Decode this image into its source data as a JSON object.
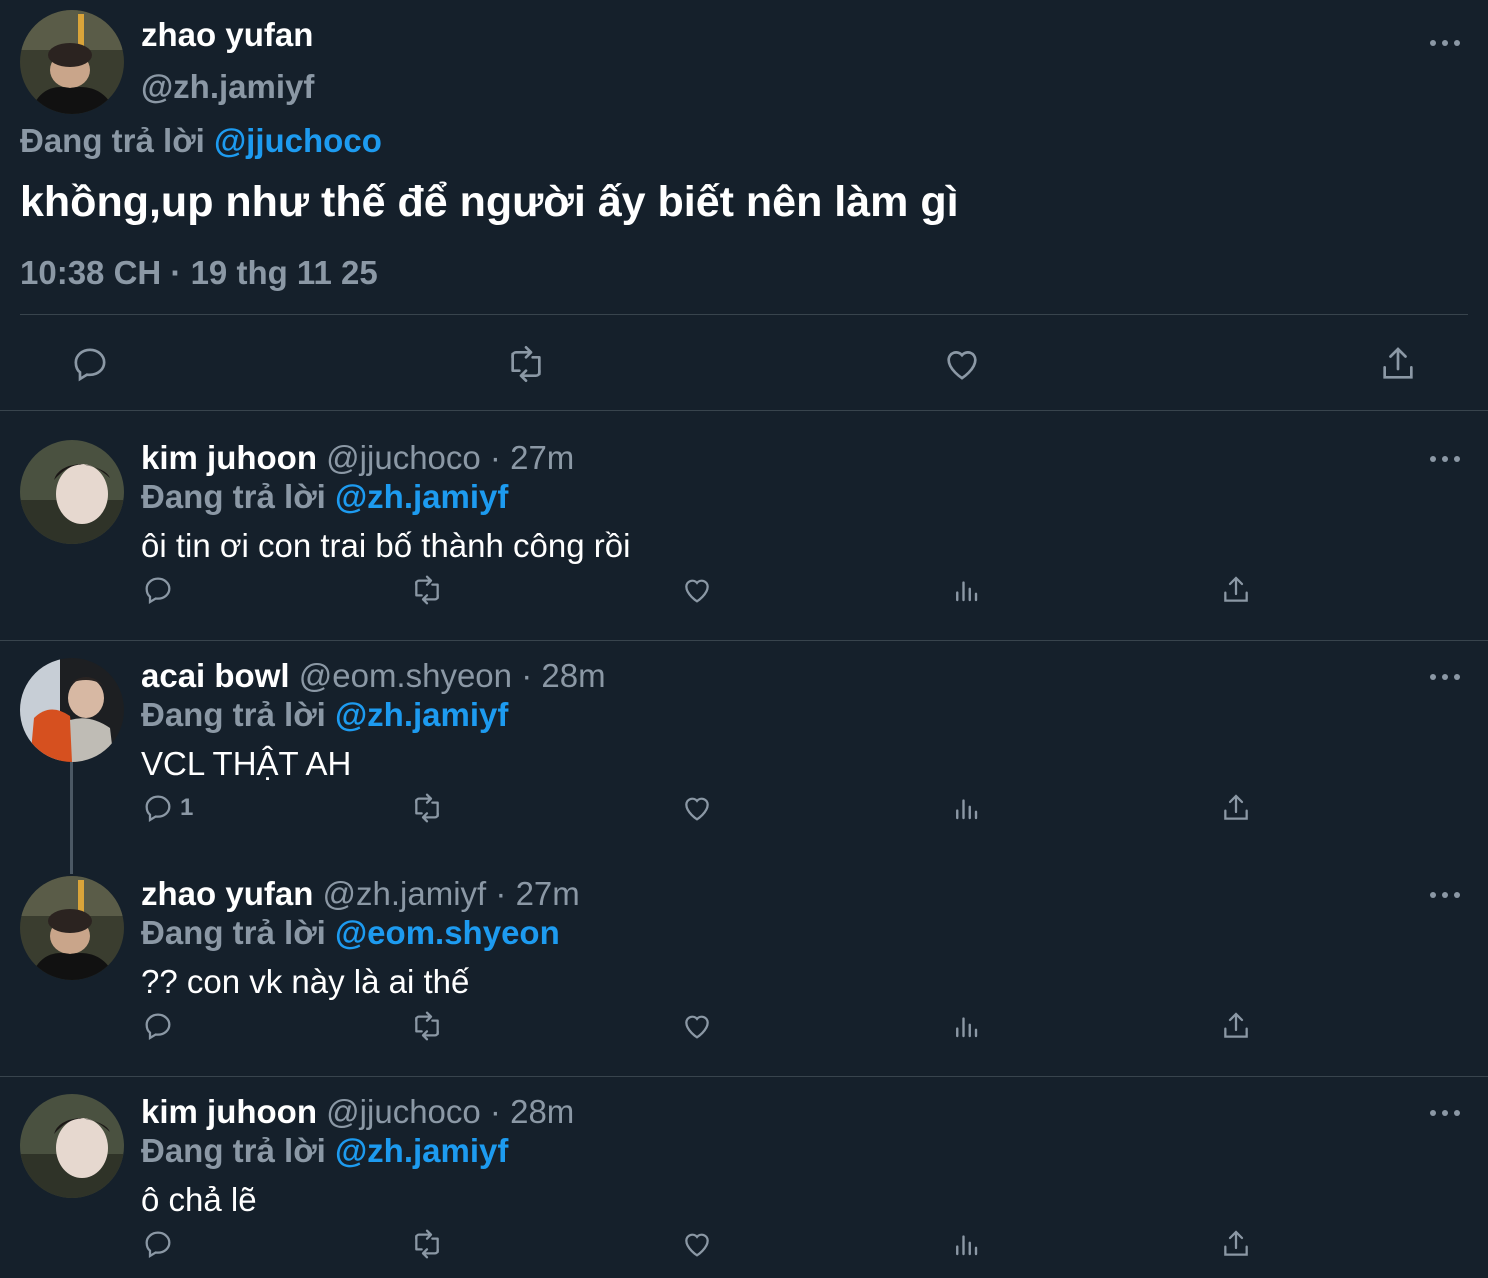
{
  "main_tweet": {
    "name": "zhao yufan",
    "handle": "@zh.jamiyf",
    "replying_prefix": "Đang trả lời",
    "replying_to": "@jjuchoco",
    "text": "khồng,up như thế để người ấy biết nên làm gì",
    "time": "10:38 CH",
    "dot": "·",
    "date": "19 thg 11 25",
    "actions": {
      "reply": "reply-icon",
      "retweet": "retweet-icon",
      "like": "heart-icon",
      "share": "share-icon"
    }
  },
  "replies": [
    {
      "name": "kim juhoon",
      "handle": "@jjuchoco",
      "time": "27m",
      "replying_prefix": "Đang trả lời",
      "replying_to": "@zh.jamiyf",
      "text": "ôi tin ơi con trai bố thành công rồi",
      "reply_count": "",
      "avatar": "avatar-b"
    },
    {
      "name": "acai bowl",
      "handle": "@eom.shyeon",
      "time": "28m",
      "replying_prefix": "Đang trả lời",
      "replying_to": "@zh.jamiyf",
      "text": "VCL THẬT AH",
      "reply_count": "1",
      "avatar": "avatar-c"
    },
    {
      "name": "zhao yufan",
      "handle": "@zh.jamiyf",
      "time": "27m",
      "replying_prefix": "Đang trả lời",
      "replying_to": "@eom.shyeon",
      "text": "?? con vk này là ai thế",
      "reply_count": "",
      "avatar": "avatar-a"
    },
    {
      "name": "kim juhoon",
      "handle": "@jjuchoco",
      "time": "28m",
      "replying_prefix": "Đang trả lời",
      "replying_to": "@zh.jamiyf",
      "text": "ô chả lẽ",
      "reply_count": "",
      "avatar": "avatar-b"
    }
  ],
  "colors": {
    "background": "#15202b",
    "text": "#ffffff",
    "muted": "#8b98a5",
    "link": "#1d9bf0",
    "separator": "#38444d"
  }
}
